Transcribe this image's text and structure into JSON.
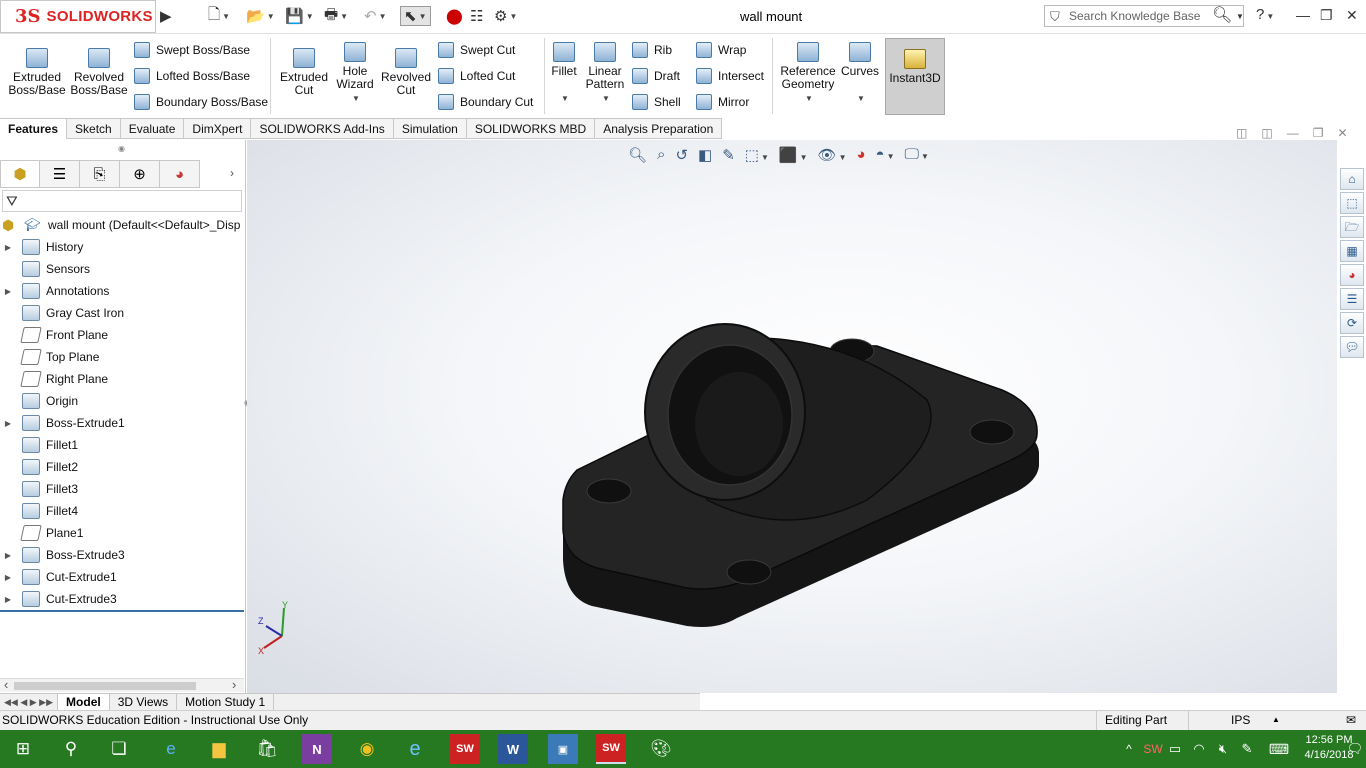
{
  "app": {
    "logo_mark": "3S",
    "logo_text": "SOLIDWORKS",
    "document_title": "wall mount"
  },
  "search": {
    "placeholder": "Search Knowledge Base"
  },
  "ribbon": {
    "features_large": [
      {
        "name": "extruded-boss-base",
        "label_1": "Extruded",
        "label_2": "Boss/Base"
      },
      {
        "name": "revolved-boss-base",
        "label_1": "Revolved",
        "label_2": "Boss/Base"
      }
    ],
    "boss_small": [
      "Swept Boss/Base",
      "Lofted Boss/Base",
      "Boundary Boss/Base"
    ],
    "cut_large": [
      {
        "name": "extruded-cut",
        "label_1": "Extruded",
        "label_2": "Cut"
      },
      {
        "name": "hole-wizard",
        "label_1": "Hole",
        "label_2": "Wizard"
      },
      {
        "name": "revolved-cut",
        "label_1": "Revolved",
        "label_2": "Cut"
      }
    ],
    "cut_small": [
      "Swept Cut",
      "Lofted Cut",
      "Boundary Cut"
    ],
    "fillet": "Fillet",
    "linear_pattern_1": "Linear",
    "linear_pattern_2": "Pattern",
    "rib_group": [
      "Rib",
      "Draft",
      "Shell"
    ],
    "wrap_group": [
      "Wrap",
      "Intersect",
      "Mirror"
    ],
    "ref_geom_1": "Reference",
    "ref_geom_2": "Geometry",
    "curves": "Curves",
    "instant3d": "Instant3D"
  },
  "command_tabs": [
    "Features",
    "Sketch",
    "Evaluate",
    "DimXpert",
    "SOLIDWORKS Add-Ins",
    "Simulation",
    "SOLIDWORKS MBD",
    "Analysis Preparation"
  ],
  "feature_tree": {
    "root": "wall mount  (Default<<Default>_Disp",
    "items": [
      "History",
      "Sensors",
      "Annotations",
      "Gray Cast Iron",
      "Front Plane",
      "Top Plane",
      "Right Plane",
      "Origin",
      "Boss-Extrude1",
      "Fillet1",
      "Fillet2",
      "Fillet3",
      "Fillet4",
      "Plane1",
      "Boss-Extrude3",
      "Cut-Extrude1",
      "Cut-Extrude3"
    ]
  },
  "bottom_tabs": [
    "Model",
    "3D Views",
    "Motion Study 1"
  ],
  "status": {
    "left": "SOLIDWORKS Education Edition - Instructional Use Only",
    "mode": "Editing Part",
    "units": "IPS"
  },
  "taskbar": {
    "time": "12:56 PM",
    "date": "4/16/2018"
  },
  "axes": {
    "x": "X",
    "y": "Y",
    "z": "Z"
  },
  "colors": {
    "taskbar": "#267821",
    "model": "#1c1c1c",
    "logo": "#dd2222",
    "tree_accent": "#3a6ea5"
  }
}
